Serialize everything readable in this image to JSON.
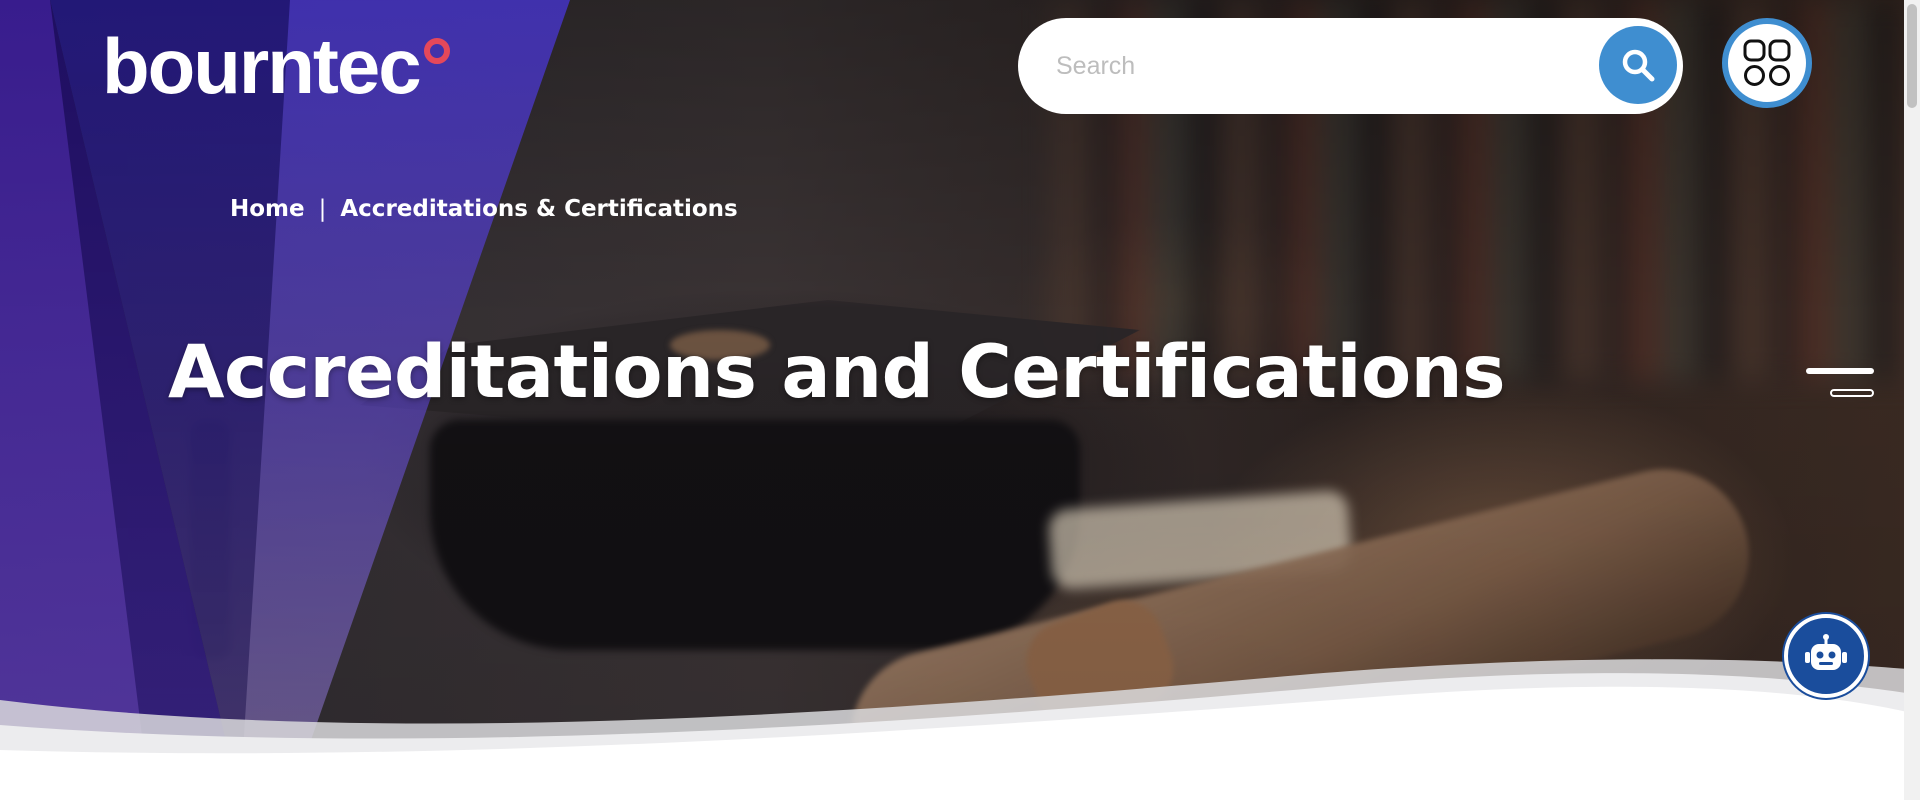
{
  "header": {
    "logo_text": "bourntec",
    "search": {
      "placeholder": "Search",
      "button_icon": "search-icon"
    },
    "apps_icon": "grid-apps-icon"
  },
  "breadcrumb": {
    "items": [
      {
        "label": "Home"
      },
      {
        "label": "Accreditations & Certifications"
      }
    ],
    "separator": "|"
  },
  "hero": {
    "title": "Accreditations and Certifications"
  },
  "menu_toggle_icon": "menu-lines-icon",
  "chatbot_icon": "robot-icon",
  "colors": {
    "brand_purple": "#3a1c96",
    "band_blue": "#4634cd",
    "search_blue": "#3f8ed0",
    "logo_dot": "#e5485a",
    "chatbot_blue": "#1a4d9c"
  }
}
